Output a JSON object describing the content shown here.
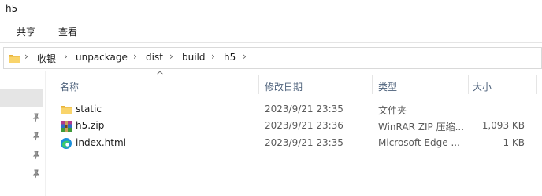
{
  "window": {
    "title": "h5"
  },
  "ribbon": {
    "tabs": [
      "共享",
      "查看"
    ]
  },
  "address": {
    "segments": [
      "收银",
      "unpackage",
      "dist",
      "build",
      "h5"
    ]
  },
  "columns": {
    "name": "名称",
    "date": "修改日期",
    "type": "类型",
    "size": "大小"
  },
  "files": [
    {
      "name": "static",
      "date": "2023/9/21 23:35",
      "type": "文件夹",
      "size": "",
      "icon": "folder-icon"
    },
    {
      "name": "h5.zip",
      "date": "2023/9/21 23:36",
      "type": "WinRAR ZIP 压缩...",
      "size": "1,093 KB",
      "icon": "winrar-icon"
    },
    {
      "name": "index.html",
      "date": "2023/9/21 23:35",
      "type": "Microsoft Edge ...",
      "size": "1 KB",
      "icon": "edge-icon"
    }
  ],
  "colors": {
    "folder": "#f4c542",
    "selection": "#e5e5e5",
    "header_text": "#4c607a"
  }
}
